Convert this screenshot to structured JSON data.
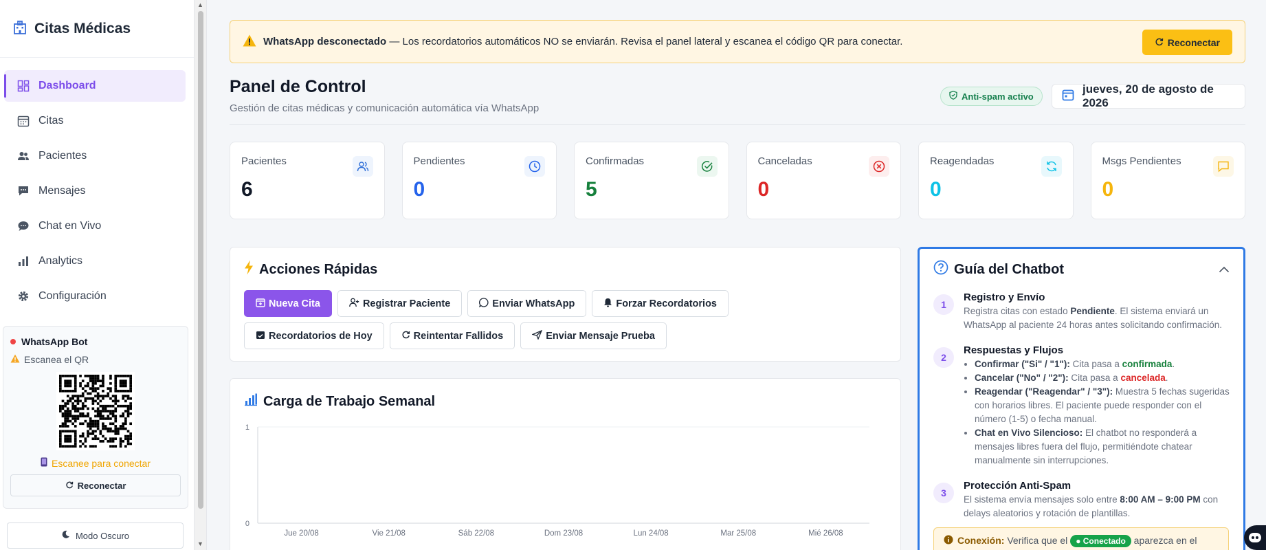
{
  "brand": {
    "title": "Citas Médicas"
  },
  "nav": {
    "dashboard": "Dashboard",
    "citas": "Citas",
    "pacientes": "Pacientes",
    "mensajes": "Mensajes",
    "chat": "Chat en Vivo",
    "analytics": "Analytics",
    "config": "Configuración"
  },
  "bot": {
    "title": "WhatsApp Bot",
    "status": "Escanea el QR",
    "hint": "Escanee para conectar",
    "reconnect": "Reconectar"
  },
  "dark_mode": "Modo Oscuro",
  "alert": {
    "bold": "WhatsApp desconectado",
    "text": " — Los recordatorios automáticos NO se enviarán. Revisa el panel lateral y escanea el código QR para conectar.",
    "button": "Reconectar"
  },
  "header": {
    "title": "Panel de Control",
    "subtitle": "Gestión de citas médicas y comunicación automática vía WhatsApp",
    "badge": "Anti-spam activo",
    "date": "jueves, 20 de agosto de 2026"
  },
  "stats": [
    {
      "label": "Pacientes",
      "value": "6",
      "color": "#111827"
    },
    {
      "label": "Pendientes",
      "value": "0",
      "color": "#2563eb"
    },
    {
      "label": "Confirmadas",
      "value": "5",
      "color": "#16803c"
    },
    {
      "label": "Canceladas",
      "value": "0",
      "color": "#dc2626"
    },
    {
      "label": "Reagendadas",
      "value": "0",
      "color": "#0ec2e6"
    },
    {
      "label": "Msgs Pendientes",
      "value": "0",
      "color": "#f5b50d"
    }
  ],
  "quick": {
    "title": "Acciones Rápidas",
    "buttons": {
      "nueva": "Nueva Cita",
      "registrar": "Registrar Paciente",
      "whatsapp": "Enviar WhatsApp",
      "forzar": "Forzar Recordatorios",
      "hoy": "Recordatorios de Hoy",
      "reintentar": "Reintentar Fallidos",
      "prueba": "Enviar Mensaje Prueba"
    }
  },
  "workload": {
    "title": "Carga de Trabajo Semanal"
  },
  "chart_data": {
    "type": "bar",
    "title": "Carga de Trabajo Semanal",
    "categories": [
      "Jue 20/08",
      "Vie 21/08",
      "Sáb 22/08",
      "Dom 23/08",
      "Lun 24/08",
      "Mar 25/08",
      "Mié 26/08"
    ],
    "values": [
      0,
      0,
      0,
      0,
      0,
      0,
      0
    ],
    "ylim": [
      0,
      1
    ],
    "yticks": [
      "0",
      "1"
    ],
    "grid": true
  },
  "guide": {
    "title": "Guía del Chatbot",
    "s1": {
      "num": "1",
      "title": "Registro y Envío",
      "t1": "Registra citas con estado ",
      "b1": "Pendiente",
      "t2": ". El sistema enviará un WhatsApp al paciente 24 horas antes solicitando confirmación."
    },
    "s2": {
      "num": "2",
      "title": "Respuestas y Flujos",
      "i1b": "Confirmar (\"Si\" / \"1\"):",
      "i1t": " Cita pasa a ",
      "i1c": "confirmada",
      "i1e": ".",
      "i2b": "Cancelar (\"No\" / \"2\"):",
      "i2t": " Cita pasa a ",
      "i2c": "cancelada",
      "i2e": ".",
      "i3b": "Reagendar (\"Reagendar\" / \"3\"):",
      "i3t": " Muestra 5 fechas sugeridas con horarios libres. El paciente puede responder con el número (1-5) o fecha manual.",
      "i4b": "Chat en Vivo Silencioso:",
      "i4t": " El chatbot no responderá a mensajes libres fuera del flujo, permitiéndote chatear manualmente sin interrupciones."
    },
    "s3": {
      "num": "3",
      "title": "Protección Anti-Spam",
      "t1": "El sistema envía mensajes solo entre ",
      "b1": "8:00 AM – 9:00 PM",
      "t2": " con delays aleatorios y rotación de plantillas."
    },
    "conn": {
      "label": "Conexión:",
      "t1": " Verifica que el ",
      "pill": "● Conectado",
      "t2": " aparezca en el"
    }
  }
}
